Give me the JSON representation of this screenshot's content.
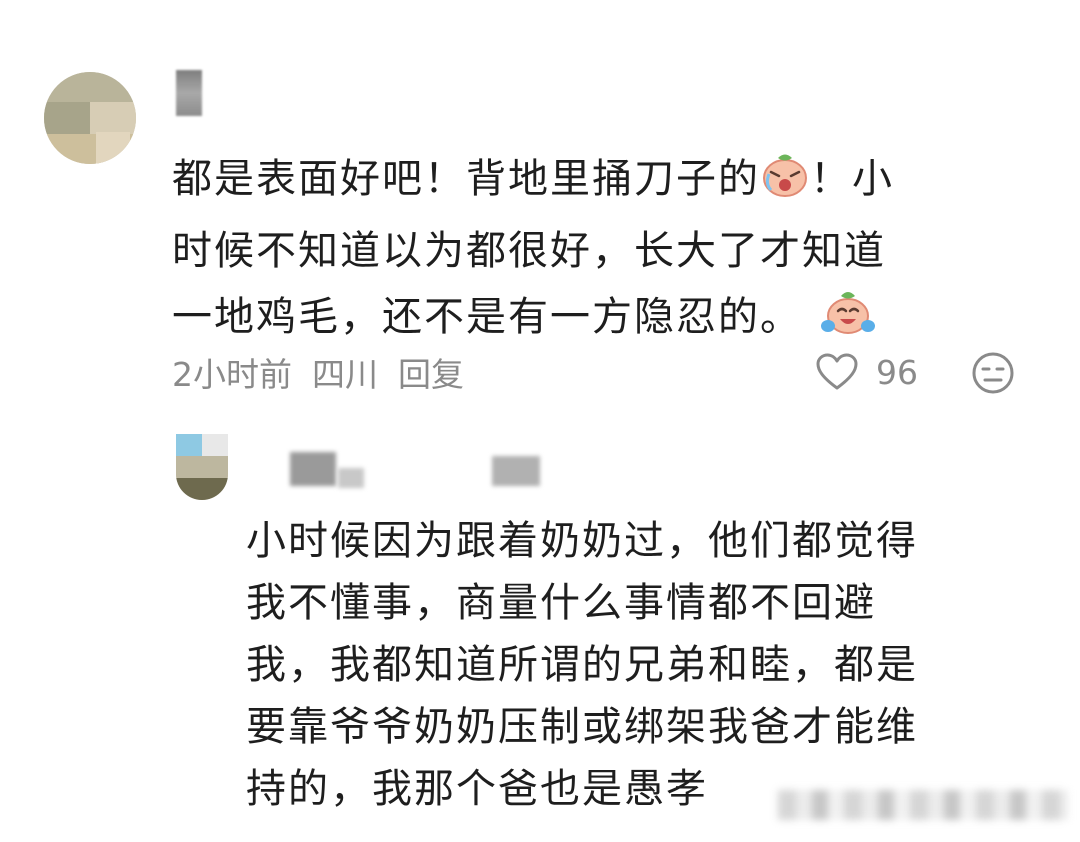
{
  "comment": {
    "text_line1": "都是表面好吧！背地里捅刀子的",
    "text_line1_after": "！小",
    "text_line2": "时候不知道以为都很好，长大了才知道",
    "text_line3": "一地鸡毛，还不是有一方隐忍的。",
    "emoji_1": "crying-emoji",
    "emoji_2": "laughing-tears-emoji",
    "time": "2小时前",
    "location": "四川",
    "reply_label": "回复",
    "like_count": "96"
  },
  "reply": {
    "lines": [
      "小时候因为跟着奶奶过，他们都觉得",
      "我不懂事，商量什么事情都不回避",
      "我，我都知道所谓的兄弟和睦，都是",
      "要靠爷爷奶奶压制或绑架我爸才能维",
      "持的，我那个爸也是愚孝"
    ]
  },
  "icons": {
    "like": "heart-outline-icon",
    "dislike": "neutral-face-icon"
  },
  "colors": {
    "text": "#1e1e1e",
    "meta": "#8a8a8a",
    "background": "#ffffff"
  }
}
